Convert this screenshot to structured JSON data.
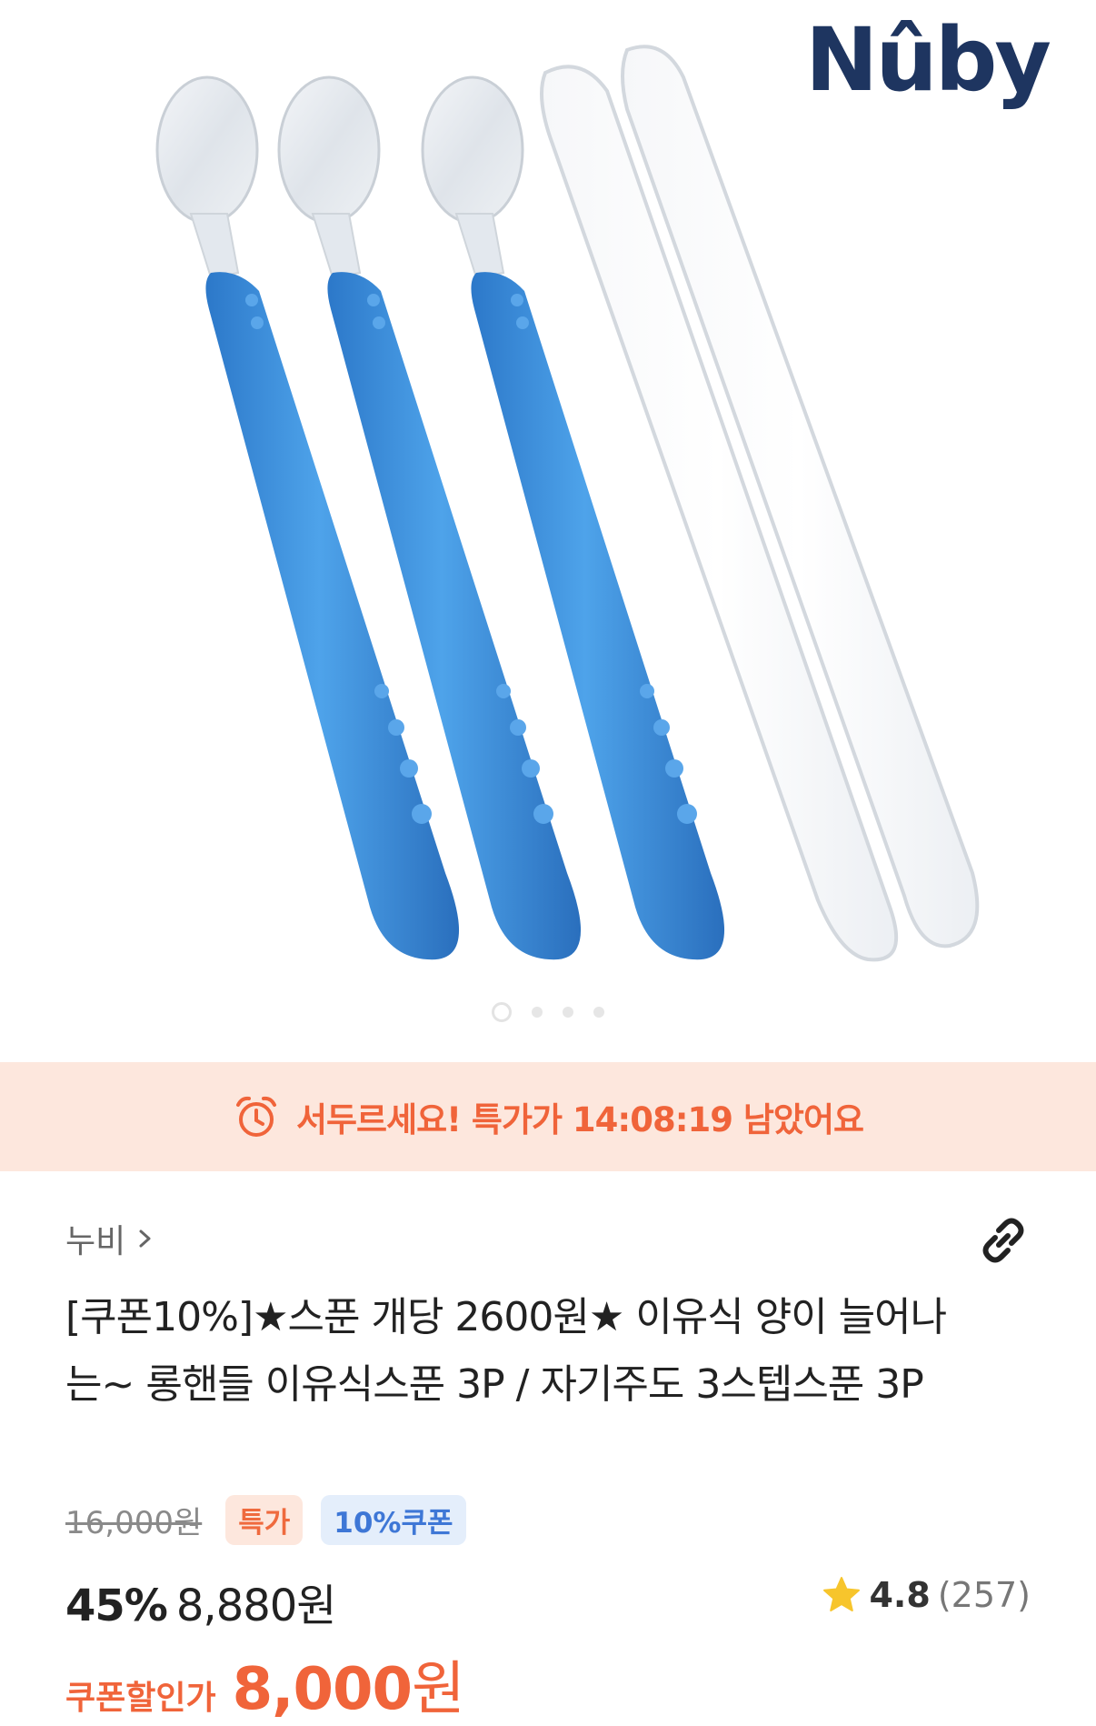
{
  "product_image": {
    "brand_logo": "Nûby",
    "alt": "롱핸들 이유식스푼 3P with case",
    "carousel": {
      "total": 4,
      "active_index": 1
    }
  },
  "timer_banner": {
    "icon": "alarm-clock-icon",
    "text": "서두르세요! 특가가 14:08:19 남았어요",
    "color": "#f0643a",
    "background": "#fde7dd"
  },
  "product": {
    "brand": "누비",
    "title": "[쿠폰10%]★스푼 개당 2600원★ 이유식 양이 늘어나는~ 롱핸들 이유식스푼 3P / 자기주도 3스텝스푼 3P",
    "original_price": "16,000원",
    "tags": [
      "특가",
      "10%쿠폰"
    ],
    "discount_rate": "45%",
    "sale_price": "8,880원",
    "rating": "4.8",
    "review_count": "(257)",
    "coupon_label": "쿠폰할인가",
    "coupon_price_number": "8,000",
    "coupon_price_unit": "원"
  },
  "colors": {
    "accent": "#f0643a",
    "spoon_blue": "#3f8fdc",
    "brand_navy": "#1e3560",
    "star": "#f7c52c"
  }
}
